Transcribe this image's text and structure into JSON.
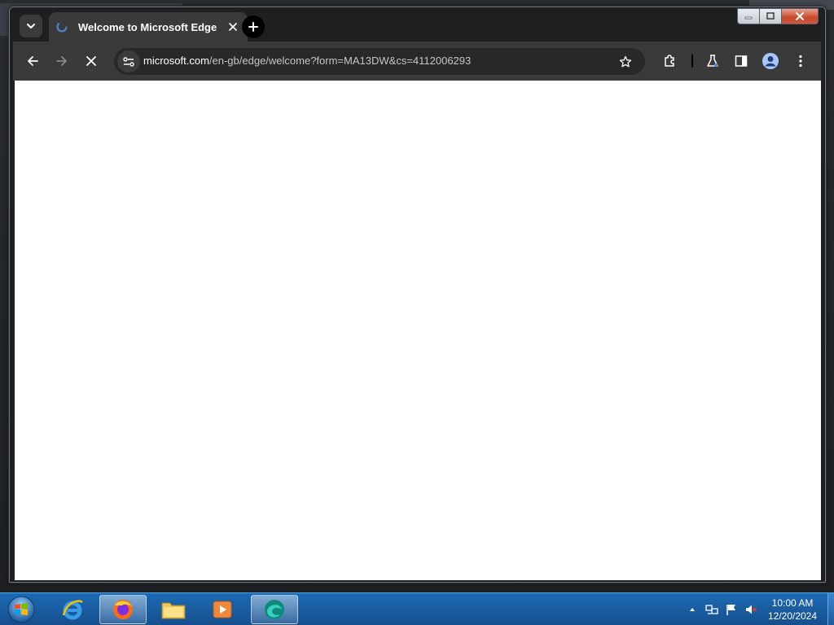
{
  "browser": {
    "tab": {
      "title": "Welcome to Microsoft Edge"
    },
    "address": {
      "host": "microsoft.com",
      "path": "/en-gb/edge/welcome?form=MA13DW&cs=4112006293"
    }
  },
  "taskbar": {
    "apps": [
      "internet-explorer",
      "firefox",
      "file-explorer",
      "media-player",
      "edge"
    ],
    "clock": {
      "time": "10:00 AM",
      "date": "12/20/2024"
    }
  },
  "colors": {
    "titlebar": "#1f1f1f",
    "toolbar": "#3a3a3a",
    "omnibox": "#282828",
    "taskbar": "#1a5ea2",
    "content": "#ffffff"
  }
}
